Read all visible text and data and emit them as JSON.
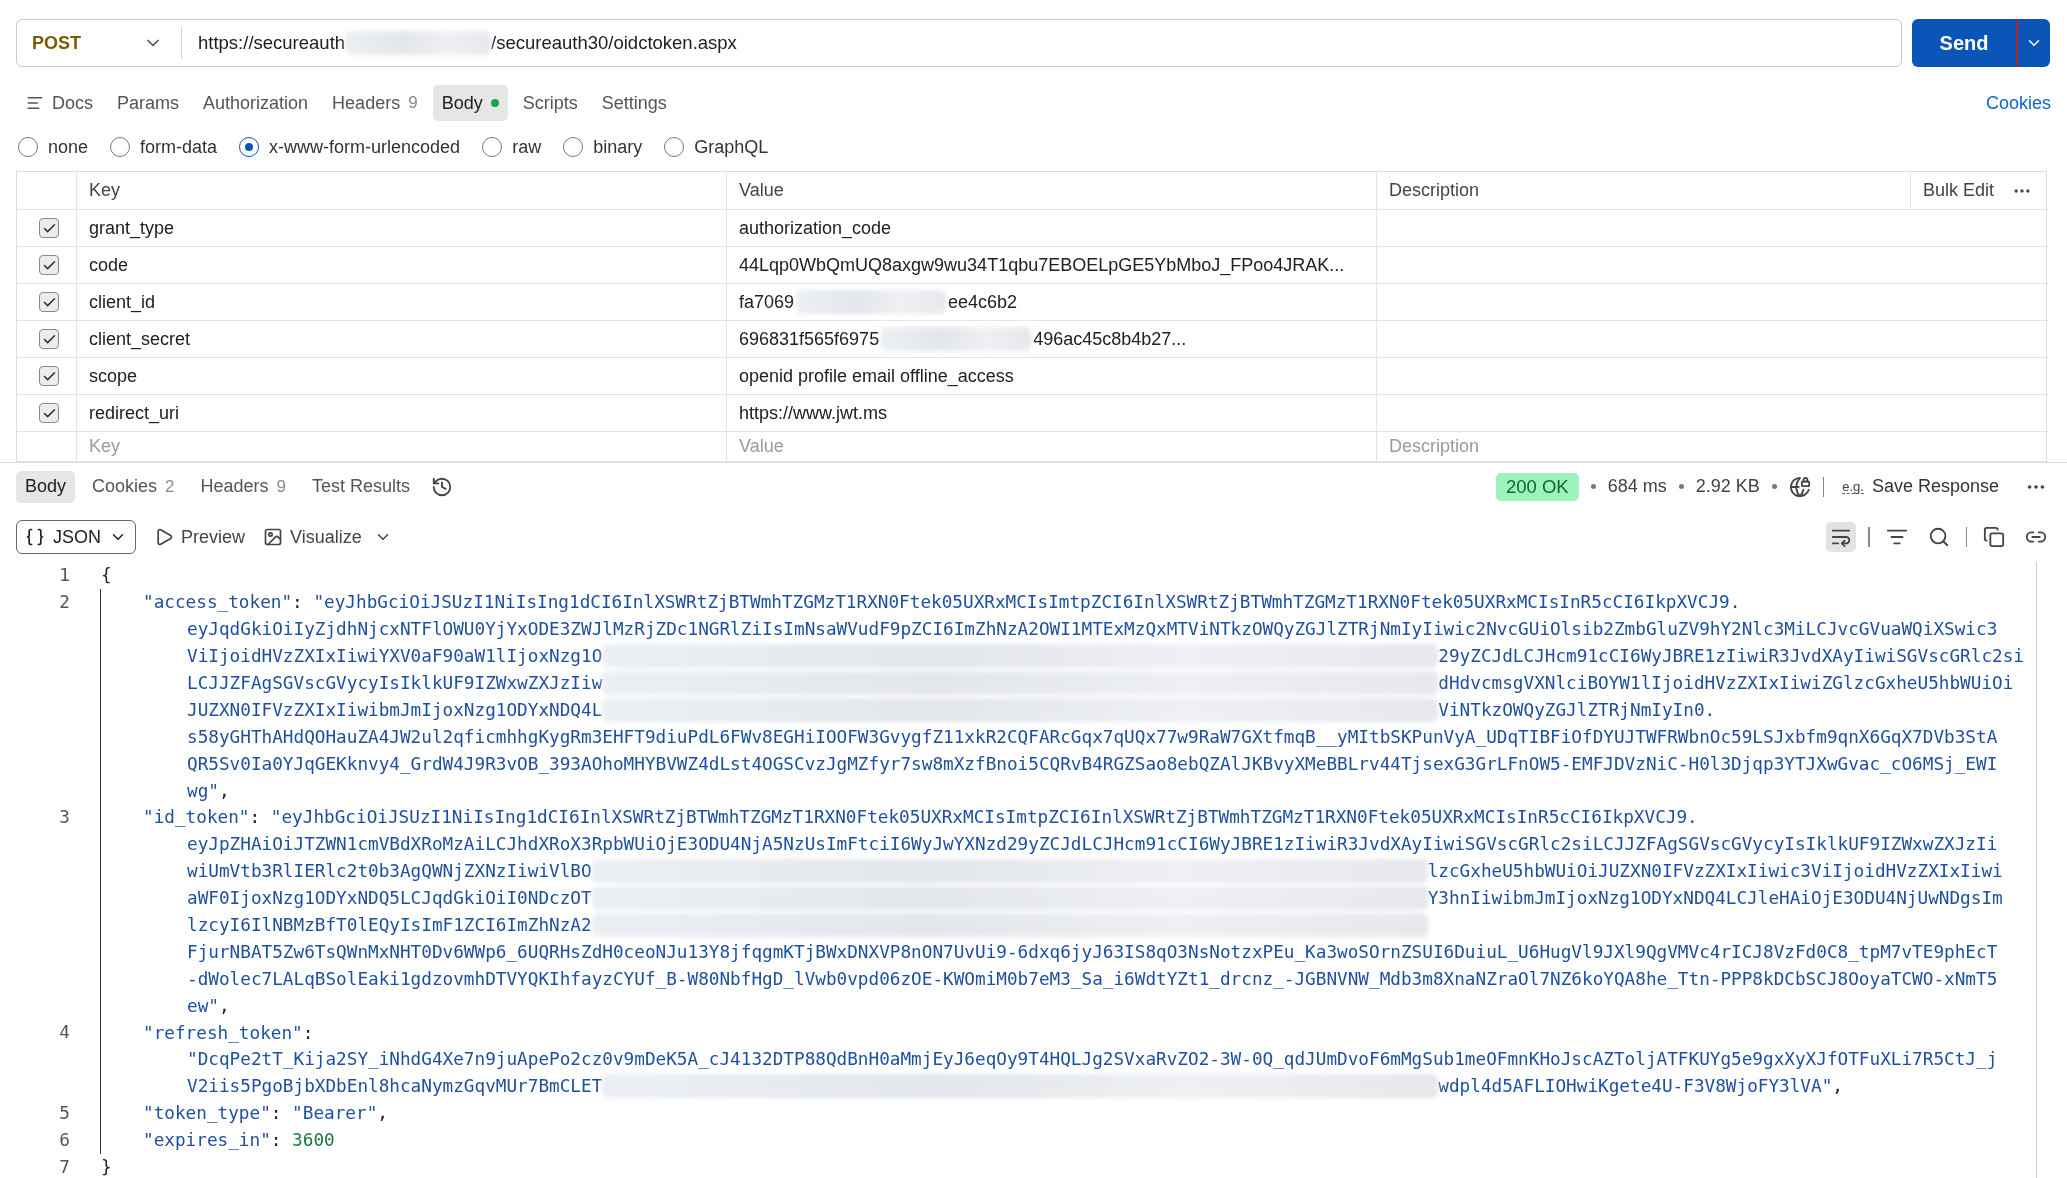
{
  "request": {
    "method": "POST",
    "url": [
      {
        "kind": "text",
        "text": "https://secureauth"
      },
      {
        "kind": "redacted"
      },
      {
        "kind": "text",
        "text": "/secureauth30/oidctoken.aspx"
      }
    ],
    "send": "Send"
  },
  "request_tabs": [
    {
      "kind": "docs",
      "label": "Docs",
      "selected": false,
      "indicator": false
    },
    {
      "label": "Params",
      "selected": false,
      "indicator": false
    },
    {
      "label": "Authorization",
      "selected": false,
      "indicator": false
    },
    {
      "label": "Headers",
      "count": "9",
      "selected": false,
      "indicator": false
    },
    {
      "label": "Body",
      "selected": true,
      "indicator": true
    },
    {
      "label": "Scripts",
      "selected": false,
      "indicator": false
    },
    {
      "label": "Settings",
      "selected": false,
      "indicator": false
    }
  ],
  "cookies_link": "Cookies",
  "body_types": [
    {
      "label": "none",
      "selected": false
    },
    {
      "label": "form-data",
      "selected": false
    },
    {
      "label": "x-www-form-urlencoded",
      "selected": true
    },
    {
      "label": "raw",
      "selected": false
    },
    {
      "label": "binary",
      "selected": false
    },
    {
      "label": "GraphQL",
      "selected": false
    }
  ],
  "params_table": {
    "columns": [
      "Key",
      "Value",
      "Description"
    ],
    "bulk_edit": "Bulk Edit",
    "rows": [
      {
        "checked": true,
        "key": "grant_type",
        "value": [
          {
            "kind": "text",
            "text": "authorization_code"
          }
        ]
      },
      {
        "checked": true,
        "key": "code",
        "value": [
          {
            "kind": "text",
            "text": "44Lqp0WbQmUQ8axgw9wu34T1qbu7EBOELpGE5YbMboJ_FPoo4JRAK..."
          }
        ]
      },
      {
        "checked": true,
        "key": "client_id",
        "value": [
          {
            "kind": "text",
            "text": "fa7069"
          },
          {
            "kind": "redacted"
          },
          {
            "kind": "text",
            "text": "ee4c6b2"
          }
        ]
      },
      {
        "checked": true,
        "key": "client_secret",
        "value": [
          {
            "kind": "text",
            "text": "696831f565f6975"
          },
          {
            "kind": "redacted"
          },
          {
            "kind": "text",
            "text": "496ac45c8b4b27..."
          }
        ]
      },
      {
        "checked": true,
        "key": "scope",
        "value": [
          {
            "kind": "text",
            "text": "openid profile email offline_access"
          }
        ]
      },
      {
        "checked": true,
        "key": "redirect_uri",
        "value": [
          {
            "kind": "text",
            "text": "https://www.jwt.ms"
          }
        ]
      }
    ],
    "new_row": {
      "key_placeholder": "Key",
      "value_placeholder": "Value",
      "description_placeholder": "Description"
    }
  },
  "response": {
    "tabs": [
      {
        "label": "Body",
        "selected": true
      },
      {
        "label": "Cookies",
        "count": "2",
        "selected": false
      },
      {
        "label": "Headers",
        "count": "9",
        "selected": false
      },
      {
        "label": "Test Results",
        "selected": false
      }
    ],
    "status": "200 OK",
    "time": "684 ms",
    "size": "2.92 KB",
    "save_icon": "e.g.",
    "save": "Save Response",
    "format": "JSON",
    "preview": "Preview",
    "visualize": "Visualize",
    "view_tools": [
      {
        "kind": "wrap",
        "selected": true
      },
      {
        "kind": "filter",
        "selected": false
      },
      {
        "kind": "search",
        "selected": false
      },
      {
        "kind": "copy",
        "selected": false
      },
      {
        "kind": "link",
        "selected": false
      }
    ]
  },
  "code": [
    {
      "number": "1",
      "rows": [
        {
          "parts": [
            {
              "kind": "punct",
              "text": "{"
            }
          ]
        }
      ]
    },
    {
      "number": "2",
      "rows": [
        {
          "parts": [
            {
              "kind": "key",
              "text": "\"access_token\""
            },
            {
              "kind": "punct",
              "text": ": "
            },
            {
              "kind": "string",
              "text": "\"eyJhbGciOiJSUzI1NiIsIng1dCI6InlXSWRtZjBTWmhTZGMzT1RXN0Ftek05UXRxMCIsImtpZCI6InlXSWRtZjBTWmhTZGMzT1RXN0Ftek05UXRxMCIsInR5cCI6IkpXVCJ9."
            }
          ]
        },
        {
          "parts": [
            {
              "kind": "string",
              "text": "eyJqdGkiOiIyZjdhNjcxNTFlOWU0YjYxODE3ZWJlMzRjZDc1NGRlZiIsImNsaWVudF9pZCI6ImZhNzA2OWI1MTExMzQxMTViNTkzOWQyZGJlZTRjNmIyIiwic2NvcGUiOlsib2ZmbGluZV9hY2Nlc3MiLCJvcGVuaWQiXSwic3"
            }
          ]
        },
        {
          "parts": [
            {
              "kind": "string",
              "text": "ViIjoidHVzZXIxIiwiYXV0aF90aW1lIjoxNzg1O"
            },
            {
              "kind": "redacted"
            },
            {
              "kind": "string",
              "text": "29yZCJdLCJHcm91cCI6WyJBRE1zIiwiR3JvdXAyIiwiSGVscGRlc2si"
            }
          ]
        },
        {
          "parts": [
            {
              "kind": "string",
              "text": "LCJJZFAgSGVscGVycyIsIklkUF9IZWxwZXJzIiw"
            },
            {
              "kind": "redacted"
            },
            {
              "kind": "string",
              "text": "dHdvcmsgVXNlciBOYW1lIjoidHVzZXIxIiwiZGlzcGxheU5hbWUiOi"
            }
          ]
        },
        {
          "parts": [
            {
              "kind": "string",
              "text": "JUZXN0IFVzZXIxIiwibmJmIjoxNzg1ODYxNDQ4L"
            },
            {
              "kind": "redacted"
            },
            {
              "kind": "string",
              "text": "ViNTkzOWQyZGJlZTRjNmIyIn0."
            }
          ]
        },
        {
          "parts": [
            {
              "kind": "string",
              "text": "s58yGHThAHdQOHauZA4JW2ul2qficmhhgKygRm3EHFT9diuPdL6FWv8EGHiIOOFW3GvygfZ11xkR2CQFARcGqx7qUQx77w9RaW7GXtfmqB__yMItbSKPunVyA_UDqTIBFiOfDYUJTWFRWbnOc59LSJxbfm9qnX6GqX7DVb3StA"
            }
          ]
        },
        {
          "parts": [
            {
              "kind": "string",
              "text": "QR5Sv0Ia0YJqGEKknvy4_GrdW4J9R3vOB_393AOhoMHYBVWZ4dLst4OGSCvzJgMZfyr7sw8mXzfBnoi5CQRvB4RGZSao8ebQZAlJKBvyXMeBBLrv44TjsexG3GrLFnOW5-EMFJDVzNiC-H0l3Djqp3YTJXwGvac_cO6MSj_EWI"
            }
          ]
        },
        {
          "parts": [
            {
              "kind": "string",
              "text": "wg\""
            },
            {
              "kind": "punct",
              "text": ","
            }
          ]
        }
      ]
    },
    {
      "number": "3",
      "rows": [
        {
          "parts": [
            {
              "kind": "key",
              "text": "\"id_token\""
            },
            {
              "kind": "punct",
              "text": ": "
            },
            {
              "kind": "string",
              "text": "\"eyJhbGciOiJSUzI1NiIsIng1dCI6InlXSWRtZjBTWmhTZGMzT1RXN0Ftek05UXRxMCIsImtpZCI6InlXSWRtZjBTWmhTZGMzT1RXN0Ftek05UXRxMCIsInR5cCI6IkpXVCJ9."
            }
          ]
        },
        {
          "parts": [
            {
              "kind": "string",
              "text": "eyJpZHAiOiJTZWN1cmVBdXRoMzAiLCJhdXRoX3RpbWUiOjE3ODU4NjA5NzUsImFtciI6WyJwYXNzd29yZCJdLCJHcm91cCI6WyJBRE1zIiwiR3JvdXAyIiwiSGVscGRlc2siLCJJZFAgSGVscGVycyIsIklkUF9IZWxwZXJzIi"
            }
          ]
        },
        {
          "parts": [
            {
              "kind": "string",
              "text": "wiUmVtb3RlIERlc2t0b3AgQWNjZXNzIiwiVlBO"
            },
            {
              "kind": "redacted"
            },
            {
              "kind": "string",
              "text": "lzcGxheU5hbWUiOiJUZXN0IFVzZXIxIiwic3ViIjoidHVzZXIxIiwi"
            }
          ]
        },
        {
          "parts": [
            {
              "kind": "string",
              "text": "aWF0IjoxNzg1ODYxNDQ5LCJqdGkiOiI0NDczOT"
            },
            {
              "kind": "redacted"
            },
            {
              "kind": "string",
              "text": "Y3hnIiwibmJmIjoxNzg1ODYxNDQ4LCJleHAiOjE3ODU4NjUwNDgsIm"
            }
          ]
        },
        {
          "parts": [
            {
              "kind": "string",
              "text": "lzcyI6IlNBMzBfT0lEQyIsImF1ZCI6ImZhNzA2"
            },
            {
              "kind": "redacted"
            }
          ]
        },
        {
          "parts": [
            {
              "kind": "string",
              "text": "FjurNBAT5Zw6TsQWnMxNHT0Dv6WWp6_6UQRHsZdH0ceoNJu13Y8jfqgmKTjBWxDNXVP8nON7UvUi9-6dxq6jyJ63IS8qO3NsNotzxPEu_Ka3woSOrnZSUI6DuiuL_U6HugVl9JXl9QgVMVc4rICJ8VzFd0C8_tpM7vTE9phEcT"
            }
          ]
        },
        {
          "parts": [
            {
              "kind": "string",
              "text": "-dWolec7LALqBSolEaki1gdzovmhDTVYQKIhfayzCYUf_B-W80NbfHgD_lVwb0vpd06zOE-KWOmiM0b7eM3_Sa_i6WdtYZt1_drcnz_-JGBNVNW_Mdb3m8XnaNZraOl7NZ6koYQA8he_Ttn-PPP8kDCbSCJ8OoyaTCWO-xNmT5"
            }
          ]
        },
        {
          "parts": [
            {
              "kind": "string",
              "text": "ew\""
            },
            {
              "kind": "punct",
              "text": ","
            }
          ]
        }
      ]
    },
    {
      "number": "4",
      "rows": [
        {
          "parts": [
            {
              "kind": "key",
              "text": "\"refresh_token\""
            },
            {
              "kind": "punct",
              "text": ":"
            }
          ]
        },
        {
          "parts": [
            {
              "kind": "string",
              "text": "\"DcqPe2tT_Kija2SY_iNhdG4Xe7n9juApePo2cz0v9mDeK5A_cJ4132DTP88QdBnH0aMmjEyJ6eqOy9T4HQLJg2SVxaRvZO2-3W-0Q_qdJUmDvoF6mMgSub1meOFmnKHoJscAZToljATFKUYg5e9gxXyXJfOTFuXLi7R5CtJ_j"
            }
          ]
        },
        {
          "parts": [
            {
              "kind": "string",
              "text": "V2iis5PgoBjbXDbEnl8hcaNymzGqvMUr7BmCLET"
            },
            {
              "kind": "redacted"
            },
            {
              "kind": "string",
              "text": "wdpl4d5AFLIOHwiKgete4U-F3V8WjoFY3lVA\""
            },
            {
              "kind": "punct",
              "text": ","
            }
          ]
        }
      ]
    },
    {
      "number": "5",
      "rows": [
        {
          "parts": [
            {
              "kind": "key",
              "text": "\"token_type\""
            },
            {
              "kind": "punct",
              "text": ": "
            },
            {
              "kind": "string",
              "text": "\"Bearer\""
            },
            {
              "kind": "punct",
              "text": ","
            }
          ]
        }
      ]
    },
    {
      "number": "6",
      "rows": [
        {
          "parts": [
            {
              "kind": "key",
              "text": "\"expires_in\""
            },
            {
              "kind": "punct",
              "text": ": "
            },
            {
              "kind": "number",
              "text": "3600"
            }
          ]
        }
      ]
    },
    {
      "number": "7",
      "rows": [
        {
          "parts": [
            {
              "kind": "punct",
              "text": "}"
            }
          ]
        }
      ]
    }
  ]
}
